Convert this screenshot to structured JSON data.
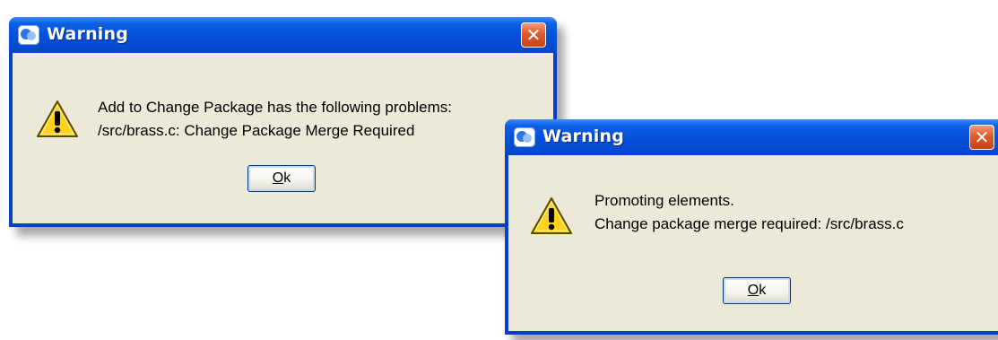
{
  "dialog1": {
    "title": "Warning",
    "close_glyph": "✕",
    "icon": "warning-triangle",
    "message_lines": [
      "Add to Change Package has the following problems:",
      "/src/brass.c: Change Package Merge Required"
    ],
    "ok_mnemonic": "O",
    "ok_rest": "k"
  },
  "dialog2": {
    "title": "Warning",
    "close_glyph": "✕",
    "icon": "warning-triangle",
    "message_lines": [
      "Promoting elements.",
      "Change package merge required: /src/brass.c"
    ],
    "ok_mnemonic": "O",
    "ok_rest": "k"
  },
  "colors": {
    "titlebar": "#0550d8",
    "client": "#ece9d8",
    "close": "#e25a2a",
    "warning_fill": "#ffd21e"
  }
}
